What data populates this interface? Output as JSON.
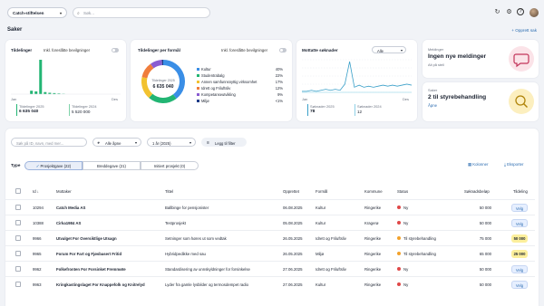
{
  "topbar": {
    "org": "Catch-stiftelsen",
    "search_placeholder": "Søk..."
  },
  "page": {
    "title": "Saker",
    "new_case": "+ Opprett sak"
  },
  "kpi1": {
    "title": "Tildelinger",
    "toggle_label": "Inkl. foreslåtte bevilgninger",
    "x_start": "Jan",
    "x_end": "Des",
    "stat1_label": "Tildelinger 2025",
    "stat1_value": "6 635 040",
    "stat2_label": "Tildelinger 2024",
    "stat2_value": "5 520 000",
    "bars": [
      0,
      0,
      0,
      0,
      10,
      8,
      100,
      6,
      4,
      3,
      2,
      1,
      0,
      0,
      0,
      0,
      0,
      0,
      0,
      0,
      0,
      0,
      0,
      0
    ]
  },
  "kpi2": {
    "title": "Tildelinger per formål",
    "toggle_label": "Inkl. foreslåtte bevilgninger",
    "donut_label": "Tildelinger 2025",
    "donut_value": "6 635 040",
    "legend": [
      {
        "label": "Kultur",
        "pct": "40%",
        "color": "#3a8ee6"
      },
      {
        "label": "Studentrabalg",
        "pct": "22%",
        "color": "#22b573"
      },
      {
        "label": "Annen samfunnsnyttig virksomhet",
        "pct": "17%",
        "color": "#f2c230"
      },
      {
        "label": "Idrett og Friluftsliv",
        "pct": "12%",
        "color": "#f07d3c"
      },
      {
        "label": "Kompetanseutvikling",
        "pct": "9%",
        "color": "#8a5cd1"
      },
      {
        "label": "Miljø",
        "pct": "<1%",
        "color": "#1f3c88"
      }
    ]
  },
  "kpi3": {
    "title": "Mottatte søknader",
    "filter": "Alle",
    "x_start": "Jan",
    "x_end": "Des",
    "stat1_label": "Søknader 2025",
    "stat1_value": "78",
    "stat2_label": "Søknader 2024",
    "stat2_value": "12",
    "series2025": [
      1,
      1,
      2,
      1,
      2,
      3,
      2,
      3,
      2,
      8,
      30,
      5,
      7,
      5,
      6,
      5,
      6,
      7,
      6,
      7,
      6,
      7,
      8,
      7
    ],
    "series2024": [
      0,
      0,
      0,
      0,
      0,
      0,
      0,
      0,
      0,
      0,
      0,
      0,
      0,
      0,
      0,
      0,
      0,
      0,
      0,
      0,
      0,
      0,
      0,
      0
    ]
  },
  "msg": {
    "title": "Meldinger",
    "headline": "Ingen nye meldinger",
    "sub": "Alt på stell"
  },
  "cases": {
    "title": "Saker",
    "headline": "2 til styrebehandling",
    "link": "Åpne"
  },
  "filters": {
    "search_placeholder": "Søk på ID, navn, med mer...",
    "status": "Alle åpne",
    "period": "1 år (2025)",
    "add_filter": "Legg til filter"
  },
  "type": {
    "label": "Type",
    "tabs": [
      "Prosjektgave (22)",
      "Breddegave (21)",
      "Initiert prosjekt (0)"
    ],
    "columns_btn": "Kolonner",
    "export_btn": "Eksporter"
  },
  "table": {
    "headers": [
      "Id",
      "Mottaker",
      "Tittel",
      "Opprettet",
      "Formål",
      "Kommune",
      "Status",
      "Søknadsbeløp",
      "Tildeling"
    ],
    "rows": [
      {
        "id": "10294",
        "mottaker": "Catch Media AS",
        "tittel": "Ballbinge for pensjonister",
        "opprettet": "06.08.2025",
        "formal": "Kultur",
        "kommune": "Ringerike",
        "status": "Ny",
        "status_color": "#e04848",
        "belop": "50 000",
        "tildeling": "Velg",
        "t_style": "velg"
      },
      {
        "id": "10388",
        "mottaker": "Cirka1984 AS",
        "tittel": "Testprosjekt",
        "opprettet": "05.08.2025",
        "formal": "Kultur",
        "kommune": "Kragerø",
        "status": "Ny",
        "status_color": "#e04848",
        "belop": "50 000",
        "tildeling": "Velg",
        "t_style": "velg"
      },
      {
        "id": "9966",
        "mottaker": "Utvalget For Oversiktlige Utsagn",
        "tittel": "Setninger som høres ut som vedtak",
        "opprettet": "26.05.2025",
        "formal": "Idrett og Friluftsliv",
        "kommune": "Ringerike",
        "status": "Til styrebehandling",
        "status_color": "#f2a22b",
        "belop": "75 000",
        "tildeling": "50 000",
        "t_style": "yellow"
      },
      {
        "id": "9965",
        "mottaker": "Forum For Fart og Fjøsbasert Fritid",
        "tittel": "Hybridpedikke med sau",
        "opprettet": "26.05.2025",
        "formal": "Miljø",
        "kommune": "Ringerike",
        "status": "Til styrebehandling",
        "status_color": "#f2a22b",
        "belop": "65 000",
        "tildeling": "25 000",
        "t_style": "yellow"
      },
      {
        "id": "9962",
        "mottaker": "Folkefronten For Forsinket Fremmøte",
        "tittel": "Standardisering av unnskyldninger for forsinkelse",
        "opprettet": "27.06.2025",
        "formal": "Idrett og Friluftsliv",
        "kommune": "Ringerike",
        "status": "Ny",
        "status_color": "#e04848",
        "belop": "50 000",
        "tildeling": "Velg",
        "t_style": "velg"
      },
      {
        "id": "9963",
        "mottaker": "Kringkastingslaget For Knappefolk og Knitrelyd",
        "tittel": "Lyder fra gamle lysbilder og termosdempet radio",
        "opprettet": "27.06.2025",
        "formal": "Kultur",
        "kommune": "Ringerike",
        "status": "Ny",
        "status_color": "#e04848",
        "belop": "50 000",
        "tildeling": "Velg",
        "t_style": "velg"
      }
    ]
  }
}
